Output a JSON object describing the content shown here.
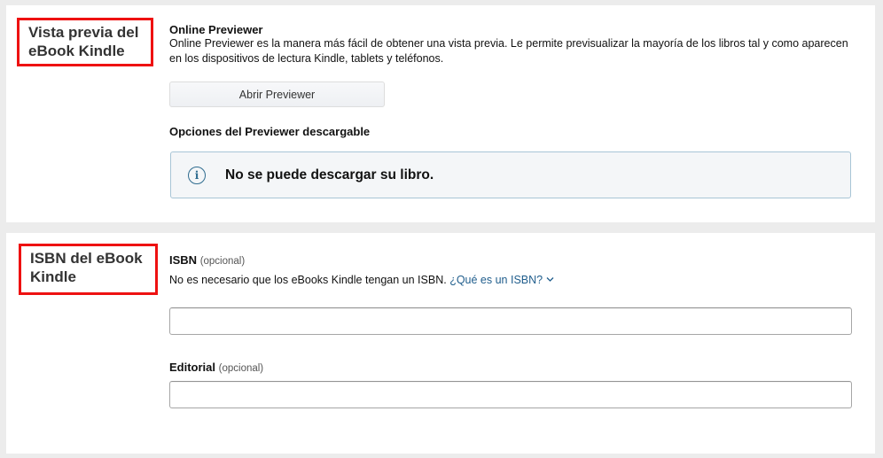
{
  "preview_section": {
    "label": "Vista previa del eBook Kindle",
    "online_previewer": {
      "title": "Online Previewer",
      "description": "Online Previewer es la manera más fácil de obtener una vista previa. Le permite previsualizar la mayoría de los libros tal y como aparecen en los dispositivos de lectura Kindle, tablets y teléfonos.",
      "button_label": "Abrir Previewer"
    },
    "downloadable": {
      "title": "Opciones del Previewer descargable",
      "alert_icon": "info-icon",
      "alert_text": "No se puede descargar su libro."
    }
  },
  "isbn_section": {
    "label": "ISBN del eBook Kindle",
    "isbn": {
      "title": "ISBN",
      "optional": "(opcional)",
      "description": "No es necesario que los eBooks Kindle tengan un ISBN.",
      "link_text": "¿Qué es un ISBN?",
      "value": ""
    },
    "publisher": {
      "title": "Editorial",
      "optional": "(opcional)",
      "value": ""
    }
  },
  "colors": {
    "highlight_border": "#ee1111",
    "link": "#1f5d8c",
    "alert_border": "#a8c5d6",
    "alert_background": "#f4f6f8"
  }
}
